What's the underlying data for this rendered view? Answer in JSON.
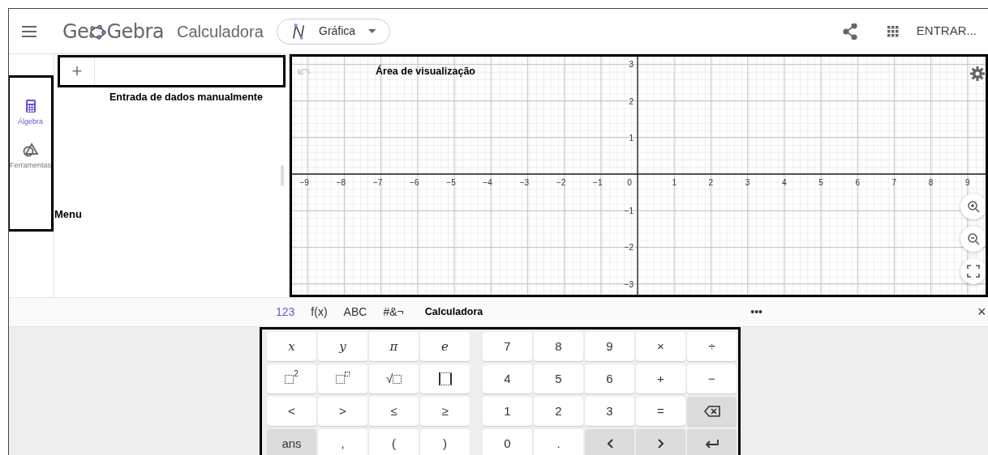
{
  "header": {
    "logo_start": "Ge",
    "logo_end": "Gebra",
    "app_title": "Calculadora",
    "view_dropdown": "Gráfica",
    "sign_in": "ENTRAR..."
  },
  "sidebar": {
    "items": [
      {
        "kind": "algebra",
        "label": "Álgebra",
        "selected": true
      },
      {
        "kind": "tools",
        "label": "Ferramentas",
        "selected": false
      }
    ]
  },
  "annotations": {
    "input": "Entrada de dados manualmente",
    "menu": "Menu",
    "graphics": "Área de visualização"
  },
  "input_button": "+",
  "graph": {
    "x_ticks": [
      "−9",
      "−8",
      "−7",
      "−6",
      "−5",
      "−4",
      "−3",
      "−2",
      "−1",
      "0",
      "1",
      "2",
      "3",
      "4",
      "5",
      "6",
      "7",
      "8",
      "9"
    ],
    "y_ticks": [
      "3",
      "2",
      "1",
      "−1",
      "−2",
      "−3"
    ]
  },
  "keyboard_tabs": [
    {
      "label": "123",
      "selected": true
    },
    {
      "label": "f(x)",
      "selected": false
    },
    {
      "label": "ABC",
      "selected": false
    },
    {
      "label": "#&¬",
      "selected": false
    }
  ],
  "keyboard_title": "Calculadora",
  "keyboard_more": "•••",
  "keyboard_close": "×",
  "keys": [
    {
      "kind": "italic",
      "label": "x",
      "shaded": false
    },
    {
      "kind": "italic",
      "label": "y",
      "shaded": false
    },
    {
      "kind": "italic",
      "label": "π",
      "shaded": false
    },
    {
      "kind": "italic",
      "label": "e",
      "shaded": false
    },
    {
      "kind": "text",
      "label": "7",
      "shaded": false
    },
    {
      "kind": "text",
      "label": "8",
      "shaded": false
    },
    {
      "kind": "text",
      "label": "9",
      "shaded": false
    },
    {
      "kind": "text",
      "label": "×",
      "shaded": false
    },
    {
      "kind": "text",
      "label": "÷",
      "shaded": false
    },
    {
      "kind": "square",
      "label": "2",
      "shaded": false
    },
    {
      "kind": "power",
      "shaded": false
    },
    {
      "kind": "sqrt",
      "label": "√",
      "shaded": false
    },
    {
      "kind": "abs",
      "shaded": false
    },
    {
      "kind": "text",
      "label": "4",
      "shaded": false
    },
    {
      "kind": "text",
      "label": "5",
      "shaded": false
    },
    {
      "kind": "text",
      "label": "6",
      "shaded": false
    },
    {
      "kind": "text",
      "label": "+",
      "shaded": false
    },
    {
      "kind": "text",
      "label": "−",
      "shaded": false
    },
    {
      "kind": "text",
      "label": "<",
      "shaded": false
    },
    {
      "kind": "text",
      "label": ">",
      "shaded": false
    },
    {
      "kind": "text",
      "label": "≤",
      "shaded": false
    },
    {
      "kind": "text",
      "label": "≥",
      "shaded": false
    },
    {
      "kind": "text",
      "label": "1",
      "shaded": false
    },
    {
      "kind": "text",
      "label": "2",
      "shaded": false
    },
    {
      "kind": "text",
      "label": "3",
      "shaded": false
    },
    {
      "kind": "text",
      "label": "=",
      "shaded": false
    },
    {
      "kind": "backspace",
      "shaded": true
    },
    {
      "kind": "text",
      "label": "ans",
      "shaded": true
    },
    {
      "kind": "text",
      "label": ",",
      "shaded": false
    },
    {
      "kind": "text",
      "label": "(",
      "shaded": false
    },
    {
      "kind": "text",
      "label": ")",
      "shaded": false
    },
    {
      "kind": "text",
      "label": "0",
      "shaded": false
    },
    {
      "kind": "text",
      "label": ".",
      "shaded": false
    },
    {
      "kind": "left",
      "shaded": true
    },
    {
      "kind": "right",
      "shaded": true
    },
    {
      "kind": "enter",
      "shaded": true
    }
  ]
}
